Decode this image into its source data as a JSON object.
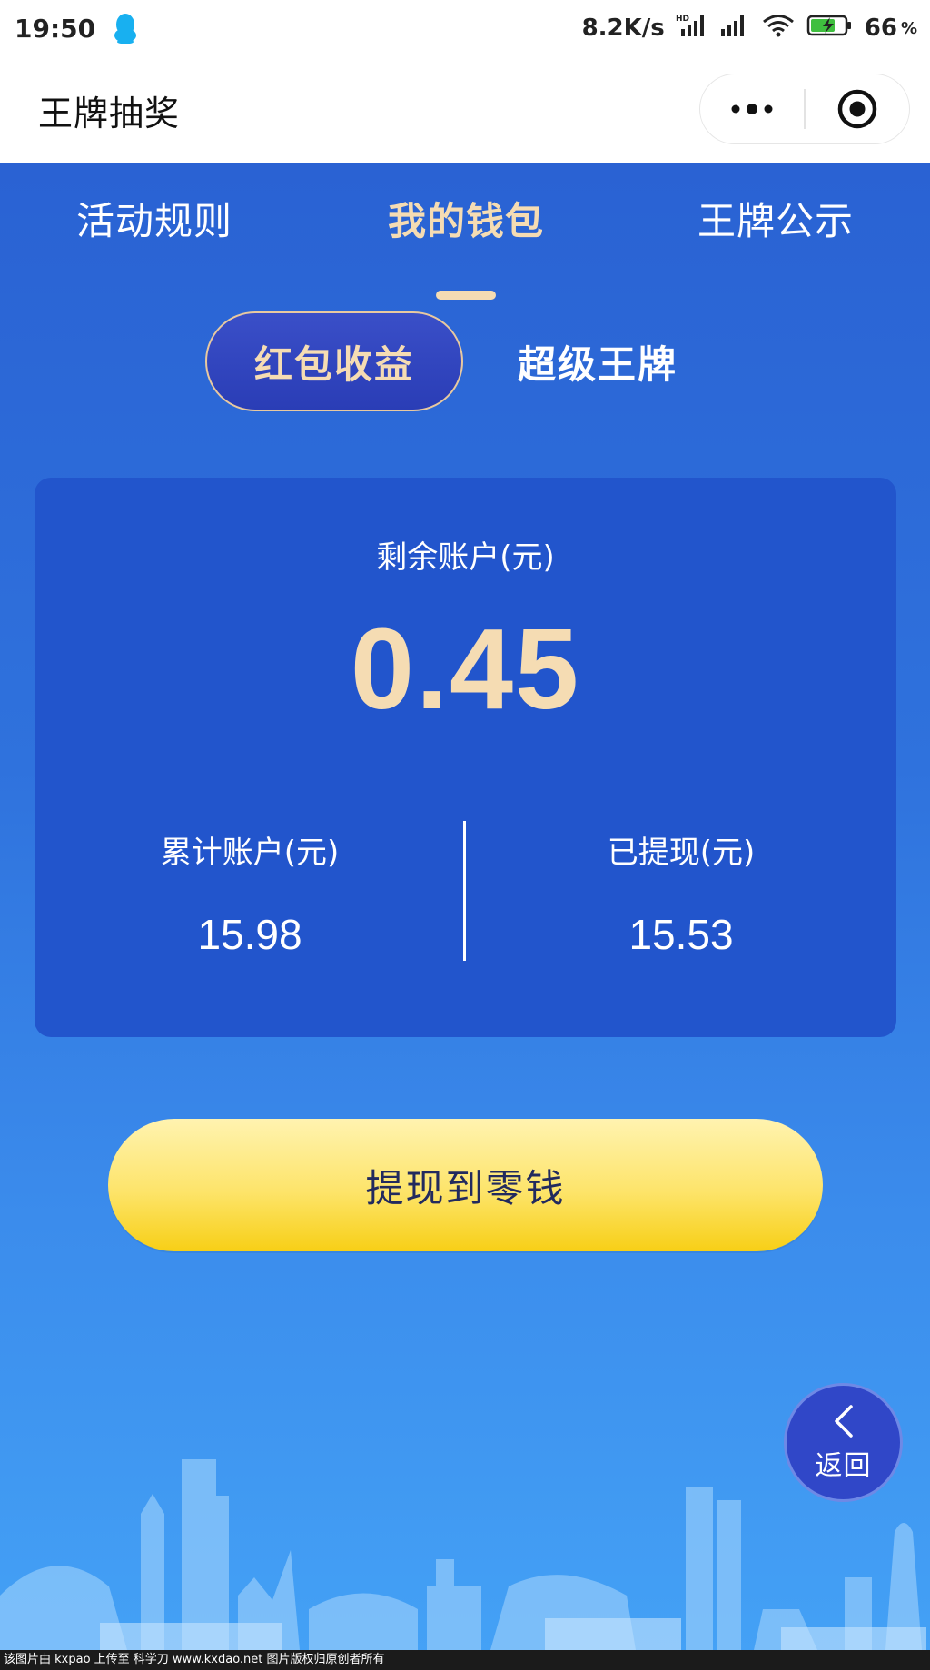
{
  "status_bar": {
    "time": "19:50",
    "net_speed": "8.2K/s",
    "battery_level": "66",
    "battery_unit": "%"
  },
  "title_bar": {
    "title": "王牌抽奖"
  },
  "tabs": [
    {
      "label": "活动规则",
      "active": false
    },
    {
      "label": "我的钱包",
      "active": true
    },
    {
      "label": "王牌公示",
      "active": false
    }
  ],
  "subtabs": {
    "active": "红包收益",
    "other": "超级王牌"
  },
  "wallet": {
    "remain_label": "剩余账户(元)",
    "remain_value": "0.45",
    "total_label": "累计账户(元)",
    "total_value": "15.98",
    "withdrawn_label": "已提现(元)",
    "withdrawn_value": "15.53"
  },
  "withdraw_button": "提现到零钱",
  "back_button": "返回",
  "footer_note": "该图片由 kxpao 上传至 科学刀 www.kxdao.net 图片版权归原创者所有",
  "colors": {
    "primary_blue": "#2a62d3",
    "card_blue": "#2255cc",
    "accent_gold": "#f5dcb3",
    "button_yellow": "#fde46a"
  }
}
